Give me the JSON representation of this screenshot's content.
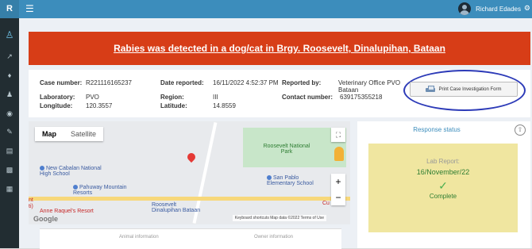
{
  "topbar": {
    "brand": "R",
    "menu_icon": "hamburger-icon",
    "user_name": "Richard Edades",
    "user_icon": "avatar-icon",
    "settings_icon": "gear-icon"
  },
  "sidebar": {
    "icons": [
      "person-icon",
      "syringe-icon",
      "dog-icon",
      "user-icon",
      "dashboard-icon",
      "edit-icon",
      "doc-icon",
      "chart-icon",
      "list-icon"
    ]
  },
  "alert": {
    "text": "Rabies was detected in a dog/cat in Brgy. Roosevelt, Dinalupihan, Bataan",
    "color": "#d73d17"
  },
  "case": {
    "case_number_label": "Case number:",
    "case_number": "R221116165237",
    "date_reported_label": "Date reported:",
    "date_reported": "16/11/2022 4:52:37 PM",
    "reported_by_label": "Reported by:",
    "reported_by": "Veterinary Office PVO Bataan",
    "laboratory_label": "Laboratory:",
    "laboratory": "PVO",
    "region_label": "Region:",
    "region": "III",
    "contact_label": "Contact number:",
    "contact": "639175355218",
    "longitude_label": "Longitude:",
    "longitude": "120.3557",
    "latitude_label": "Latitude:",
    "latitude": "14.8559"
  },
  "print_button": {
    "label": "Print Case Investigation Form"
  },
  "map": {
    "tab_map": "Map",
    "tab_satellite": "Satellite",
    "places": {
      "roosevelt_park": "Roosevelt National Park",
      "new_cabalan": "New Cabalan National High School",
      "pahuway": "Pahuway Mountain Resorts",
      "san_pablo": "San Pablo Elementary School",
      "roosevelt_town": "Roosevelt Dinalupihan Bataan",
      "anne_raquel": "Anne Raquel's Resort",
      "cut": "Cu",
      "left_label": "nt",
      "left_label2": "ti)"
    },
    "footer": "Keyboard shortcuts   Map data ©2022   Terms of Use",
    "google": "Google"
  },
  "form": {
    "animal_info": "Animal information",
    "owner_info": "Owner information"
  },
  "response": {
    "title": "Response status",
    "lab_title": "Lab Report:",
    "lab_date": "16/November/22",
    "lab_status": "Complete"
  }
}
